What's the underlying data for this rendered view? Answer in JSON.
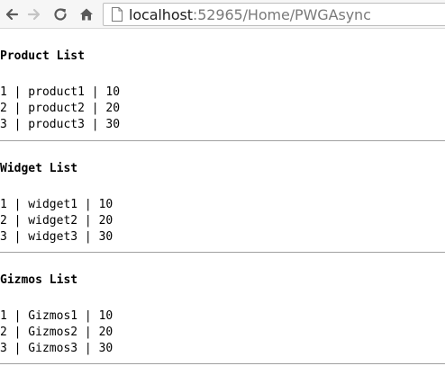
{
  "browser": {
    "url_host": "localhost",
    "url_rest": ":52965/Home/PWGAsync"
  },
  "sections": [
    {
      "title": "Product List",
      "rows": [
        "1 | product1 | 10",
        "2 | product2 | 20",
        "3 | product3 | 30"
      ]
    },
    {
      "title": "Widget List",
      "rows": [
        "1 | widget1 | 10",
        "2 | widget2 | 20",
        "3 | widget3 | 30"
      ]
    },
    {
      "title": "Gizmos List",
      "rows": [
        "1 | Gizmos1 | 10",
        "2 | Gizmos2 | 20",
        "3 | Gizmos3 | 30"
      ]
    }
  ]
}
